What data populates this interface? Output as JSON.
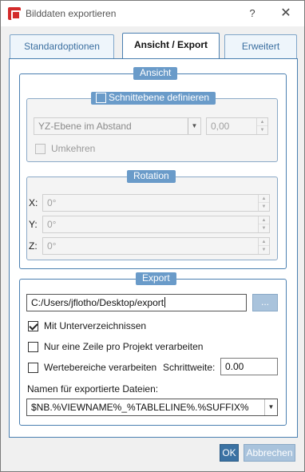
{
  "window": {
    "title": "Bilddaten exportieren",
    "help_glyph": "?",
    "close_glyph": "✕"
  },
  "tabs": [
    {
      "label": "Standardoptionen",
      "active": false
    },
    {
      "label": "Ansicht / Export",
      "active": true
    },
    {
      "label": "Erweitert",
      "active": false
    }
  ],
  "ansicht": {
    "title": "Ansicht",
    "schnittebene": {
      "title": "Schnittebene definieren",
      "checked": false,
      "plane_select": "YZ-Ebene im Abstand",
      "distance": "0,00",
      "umkehren_label": "Umkehren",
      "umkehren_checked": false
    },
    "rotation": {
      "title": "Rotation",
      "x_label": "X:",
      "x_value": "0°",
      "y_label": "Y:",
      "y_value": "0°",
      "z_label": "Z:",
      "z_value": "0°"
    }
  },
  "export": {
    "title": "Export",
    "path": "C:/Users/jflotho/Desktop/export",
    "browse_label": "...",
    "subdirs_label": "Mit Unterverzeichnissen",
    "subdirs_checked": true,
    "one_row_label": "Nur eine Zeile pro Projekt verarbeiten",
    "one_row_checked": false,
    "ranges_label": "Wertebereiche verarbeiten",
    "ranges_checked": false,
    "step_label": "Schrittweite:",
    "step_value": "0.00",
    "filenames_label": "Namen für exportierte Dateien:",
    "filenames_value": "$NB.%VIEWNAME%_%TABLELINE%.%SUFFIX%"
  },
  "footer": {
    "ok_label": "OK",
    "cancel_label": "Abbrechen"
  },
  "colors": {
    "accent": "#4a7fb0",
    "group_title_bg": "#6a9bc9",
    "ok_bg": "#3b72a3",
    "disabled_btn_bg": "#a9c3dc"
  }
}
